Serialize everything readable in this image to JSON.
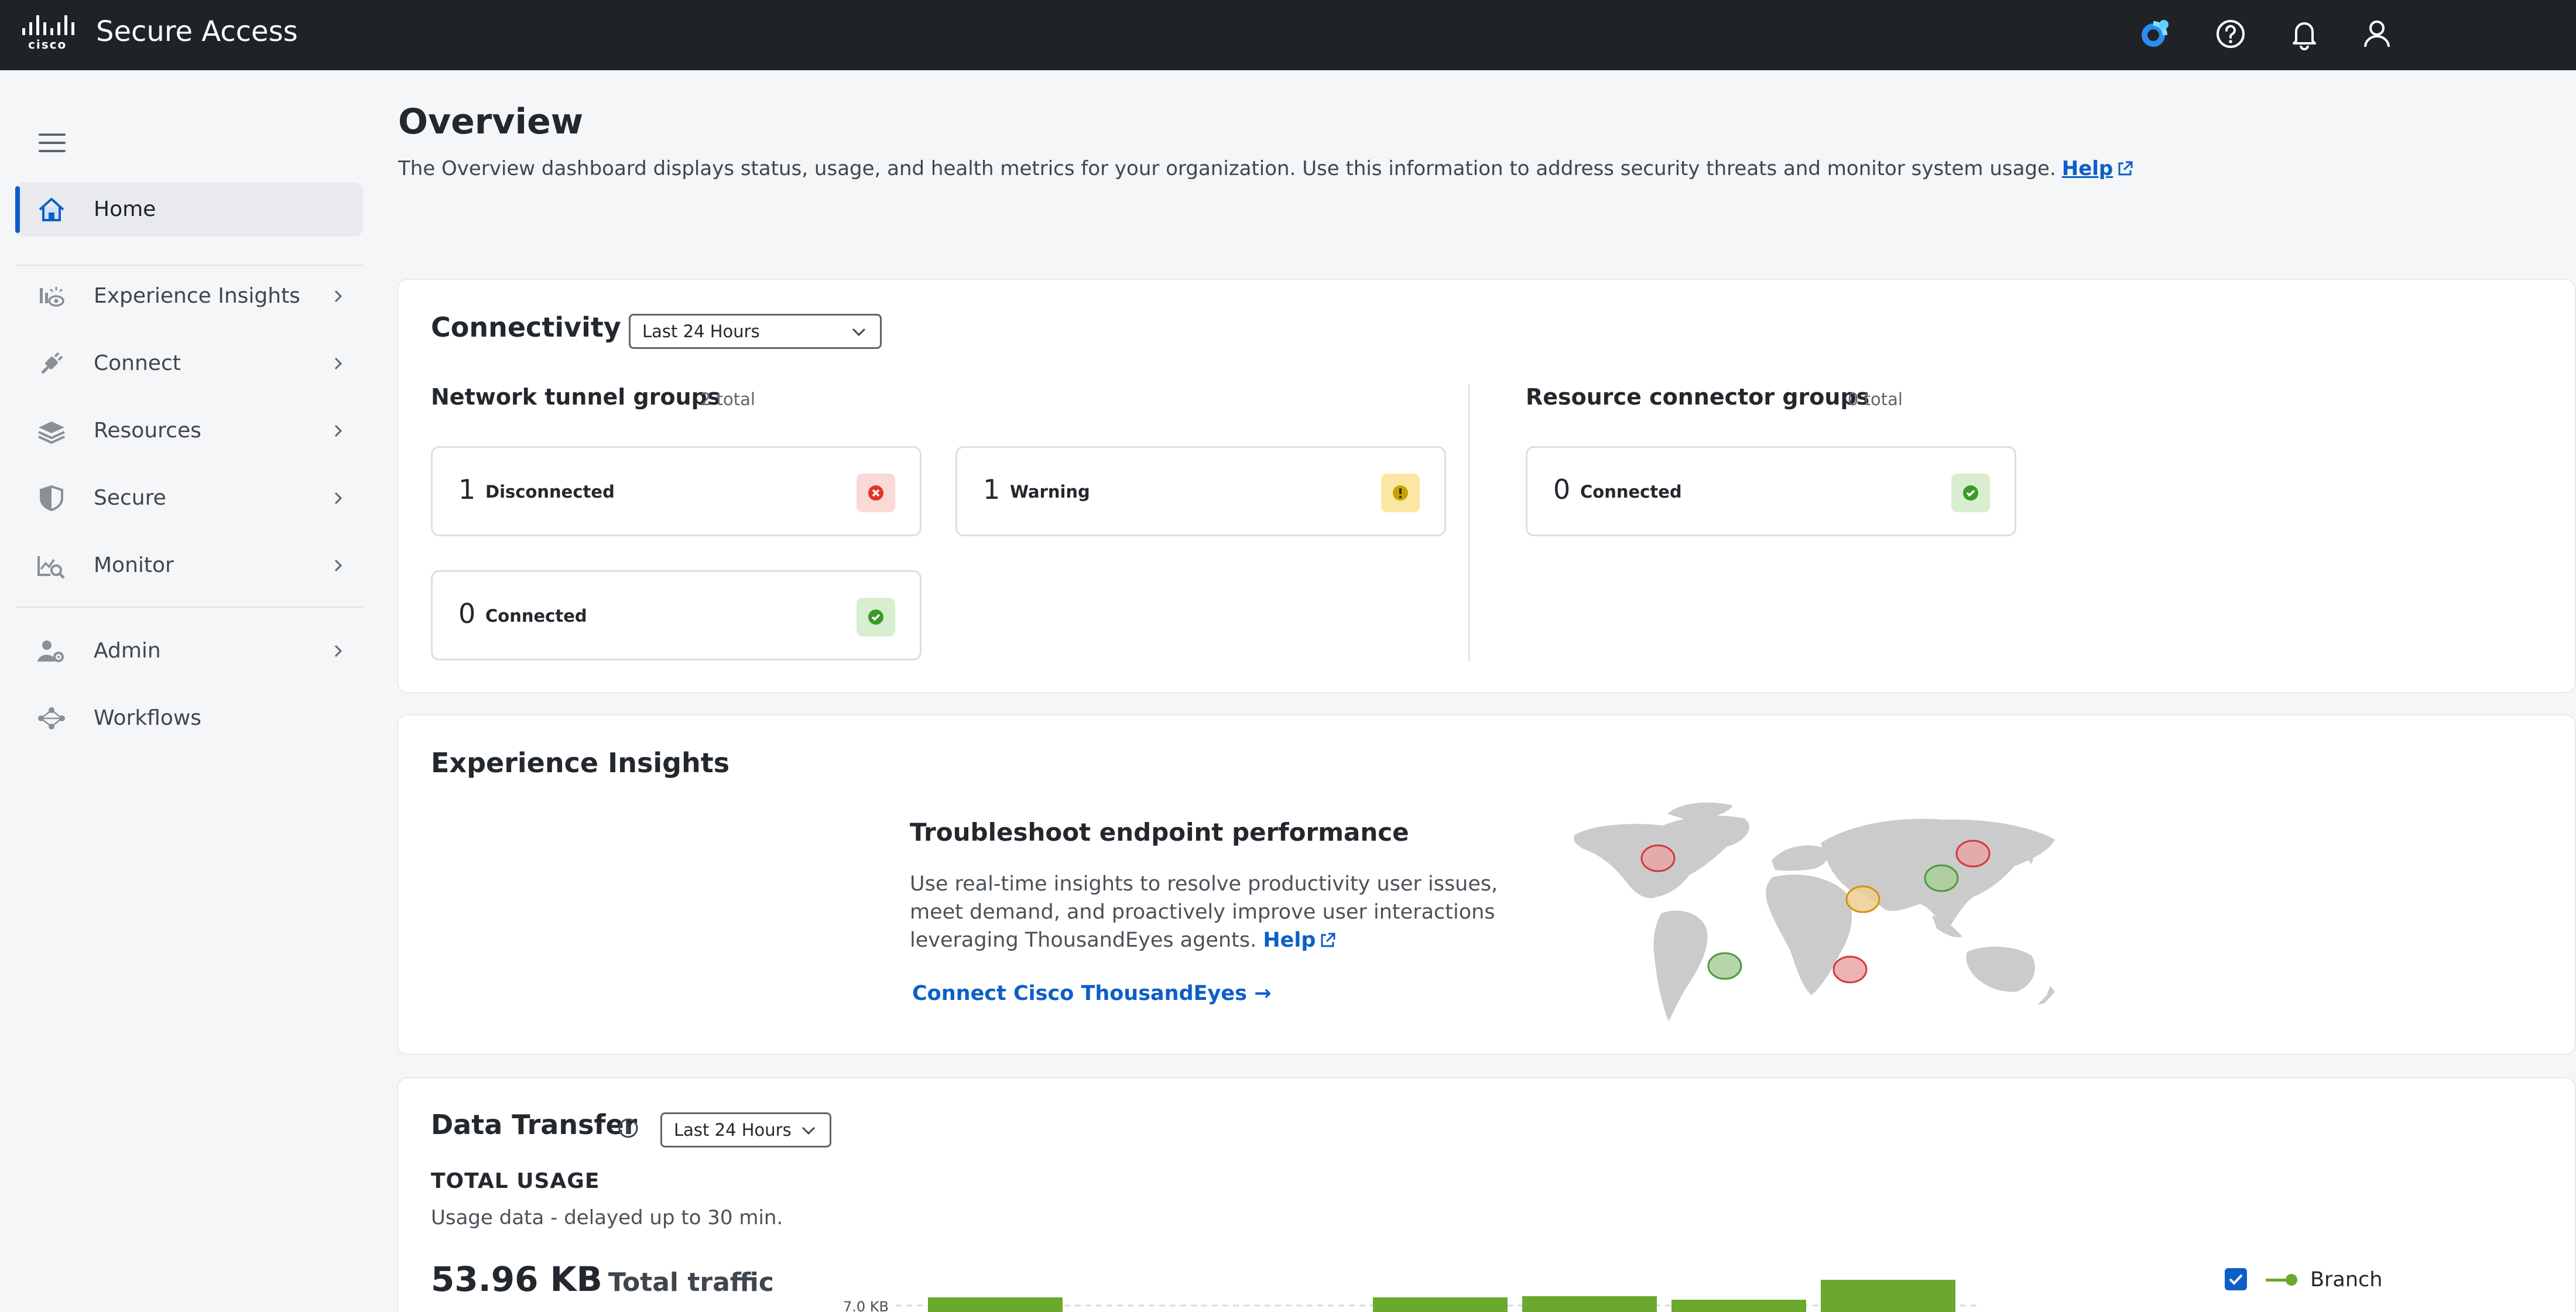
{
  "app": {
    "logo_text": "cisco",
    "title": "Secure Access"
  },
  "topbar": {
    "icons": [
      "ai-assistant-icon",
      "help-icon",
      "bell-icon",
      "user-icon"
    ]
  },
  "sidebar": {
    "items": [
      {
        "label": "Home",
        "icon": "home-icon",
        "active": true
      },
      {
        "label": "Experience Insights",
        "icon": "experience-insights-icon"
      },
      {
        "label": "Connect",
        "icon": "plug-icon"
      },
      {
        "label": "Resources",
        "icon": "stack-icon"
      },
      {
        "label": "Secure",
        "icon": "shield-icon"
      },
      {
        "label": "Monitor",
        "icon": "monitor-icon"
      },
      {
        "label": "Admin",
        "icon": "admin-icon"
      },
      {
        "label": "Workflows",
        "icon": "workflows-icon"
      }
    ]
  },
  "page": {
    "title": "Overview",
    "description": "The Overview dashboard displays status, usage, and health metrics for your organization. Use this information to address security threats and monitor system usage.",
    "help_label": "Help"
  },
  "connectivity": {
    "title": "Connectivity",
    "range": "Last 24 Hours",
    "tunnel_groups": {
      "title": "Network tunnel groups",
      "count": "2 total",
      "stats": [
        {
          "value": "1",
          "label": "Disconnected",
          "status": "error"
        },
        {
          "value": "1",
          "label": "Warning",
          "status": "warning"
        },
        {
          "value": "0",
          "label": "Connected",
          "status": "ok"
        }
      ]
    },
    "connector_groups": {
      "title": "Resource connector groups",
      "count": "0 total",
      "stats": [
        {
          "value": "0",
          "label": "Connected",
          "status": "ok"
        }
      ]
    }
  },
  "experience": {
    "title": "Experience Insights",
    "heading": "Troubleshoot endpoint performance",
    "text": "Use real-time insights to resolve productivity user issues, meet demand, and proactively improve user interactions leveraging ThousandEyes agents.",
    "help_label": "Help",
    "link": "Connect Cisco ThousandEyes →"
  },
  "data_transfer": {
    "title": "Data Transfer",
    "range": "Last 24 Hours",
    "heading": "TOTAL USAGE",
    "subtitle": "Usage data - delayed up to 30 min.",
    "total_value": "53.96 KB",
    "total_label": "Total traffic",
    "legend": "Branch",
    "y_tick": "7.0 KB"
  },
  "colors": {
    "topbar": "#202326",
    "accent": "#0d5fc7",
    "error": "#e2342a",
    "warning": "#c9a200",
    "ok": "#3c9a2a",
    "bar": "#6aa82e"
  }
}
